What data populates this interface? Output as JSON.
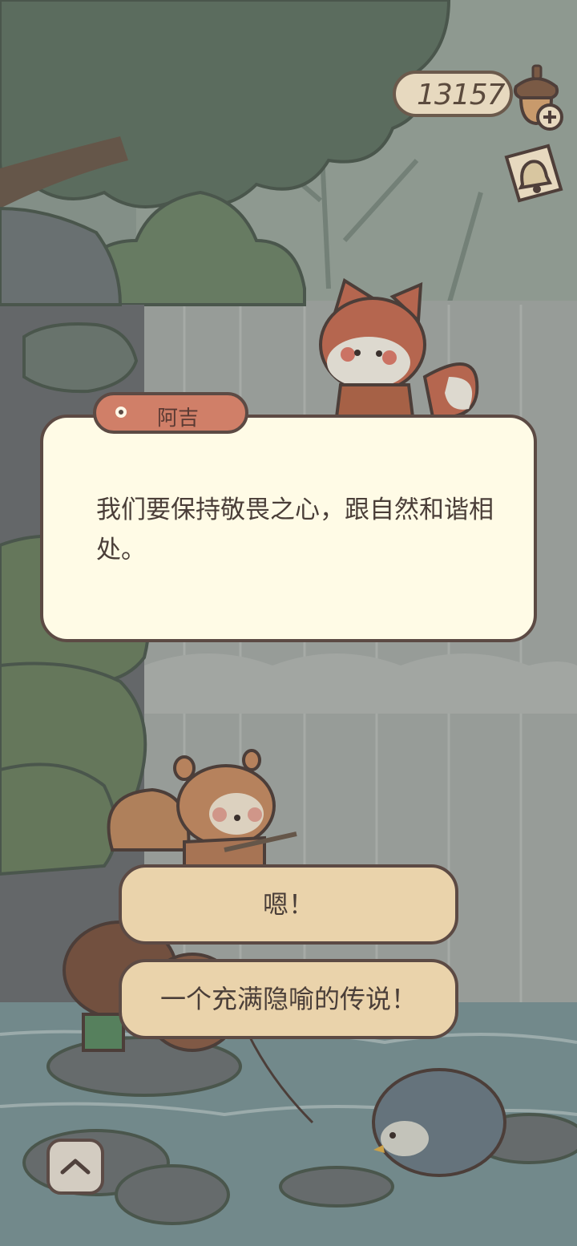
{
  "hud": {
    "acorn_count": "13157",
    "currency_icon": "acorn-icon",
    "add_icon": "plus-icon",
    "notice_icon": "bell-icon"
  },
  "dialog": {
    "speaker": "阿吉",
    "text": "我们要保持敬畏之心，跟自然和谐相处。"
  },
  "choices": [
    {
      "label": "嗯！"
    },
    {
      "label": "一个充满隐喻的传说！"
    }
  ],
  "controls": {
    "expand_icon": "chevron-up-icon"
  },
  "colors": {
    "accent": "#d07f68",
    "dialog_bg": "#fffbe6",
    "choice_bg": "#ead3ab",
    "outline": "#5c4a44"
  }
}
